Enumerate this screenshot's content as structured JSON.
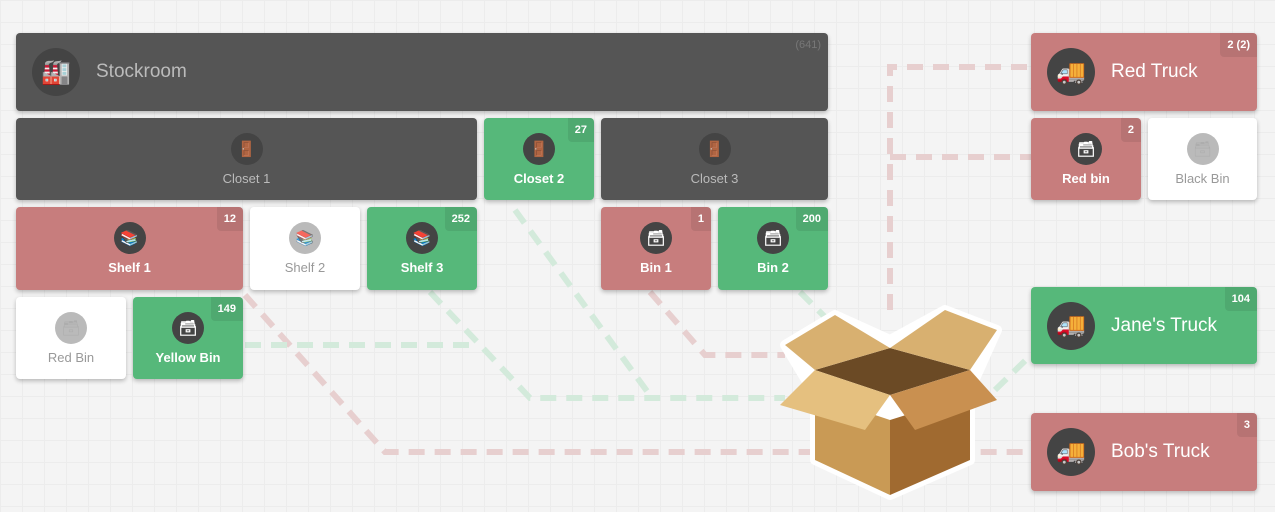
{
  "colors": {
    "dark": "#555555",
    "red": "#c77d7d",
    "green": "#56b87a",
    "white": "#ffffff"
  },
  "stockroom": {
    "label": "Stockroom",
    "count": "(641)",
    "icon": "warehouse-icon"
  },
  "closets": [
    {
      "label": "Closet 1",
      "count": "",
      "status": "dark"
    },
    {
      "label": "Closet 2",
      "count": "27",
      "status": "green"
    },
    {
      "label": "Closet 3",
      "count": "",
      "status": "dark"
    }
  ],
  "shelves": [
    {
      "label": "Shelf 1",
      "count": "12",
      "status": "red"
    },
    {
      "label": "Shelf 2",
      "count": "",
      "status": "white"
    },
    {
      "label": "Shelf 3",
      "count": "252",
      "status": "green"
    }
  ],
  "bins": [
    {
      "label": "Bin 1",
      "count": "1",
      "status": "red"
    },
    {
      "label": "Bin 2",
      "count": "200",
      "status": "green"
    },
    {
      "label": "Red Bin",
      "count": "",
      "status": "white"
    },
    {
      "label": "Yellow Bin",
      "count": "149",
      "status": "green"
    }
  ],
  "trucks": [
    {
      "label": "Red Truck",
      "count": "2 (2)",
      "status": "red"
    },
    {
      "label": "Jane's Truck",
      "count": "104",
      "status": "green"
    },
    {
      "label": "Bob's Truck",
      "count": "3",
      "status": "red"
    }
  ],
  "truck_bins": [
    {
      "label": "Red bin",
      "count": "2",
      "status": "red"
    },
    {
      "label": "Black Bin",
      "count": "",
      "status": "white"
    }
  ]
}
